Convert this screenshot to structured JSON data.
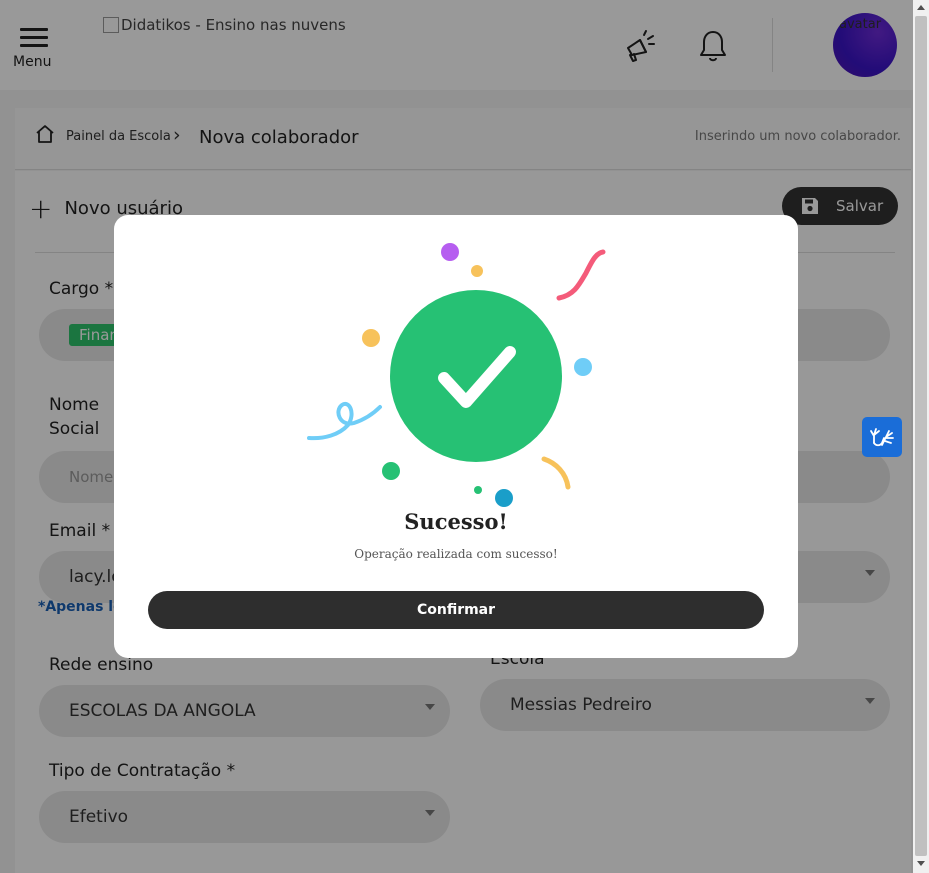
{
  "header": {
    "menu_label": "Menu",
    "logo_alt": "Didatikos - Ensino nas nuvens",
    "avatar_alt": "avatar"
  },
  "breadcrumb": {
    "home": "Painel da Escola",
    "separator": "›",
    "current": "Nova colaborador",
    "hint": "Inserindo um novo colaborador."
  },
  "form": {
    "title": "Novo usuário",
    "save_label": "Salvar",
    "cargo_label": "Cargo *",
    "cargo_chip": "Finan",
    "nome_social_label_1": "Nome",
    "nome_social_label_2": "Social",
    "nome_social_placeholder": "Nome",
    "email_label": "Email *",
    "email_value": "lacy.le",
    "email_note": "*Apenas let",
    "rede_label": "Rede ensino",
    "rede_value": "ESCOLAS DA ANGOLA",
    "escola_label": "Escola",
    "escola_value": "Messias Pedreiro",
    "contratacao_label": "Tipo de Contratação *",
    "contratacao_value": "Efetivo"
  },
  "modal": {
    "title": "Sucesso!",
    "message": "Operação realizada com sucesso!",
    "confirm_label": "Confirmar"
  },
  "colors": {
    "success_green": "#26c174",
    "button_dark": "#2e2e2e",
    "a11y_blue": "#1a6dd8"
  },
  "icons": [
    "menu-icon",
    "megaphone-icon",
    "bell-icon",
    "home-icon",
    "chevron-right-icon",
    "plus-icon",
    "floppy-disk-icon",
    "check-icon",
    "sign-language-icon"
  ]
}
